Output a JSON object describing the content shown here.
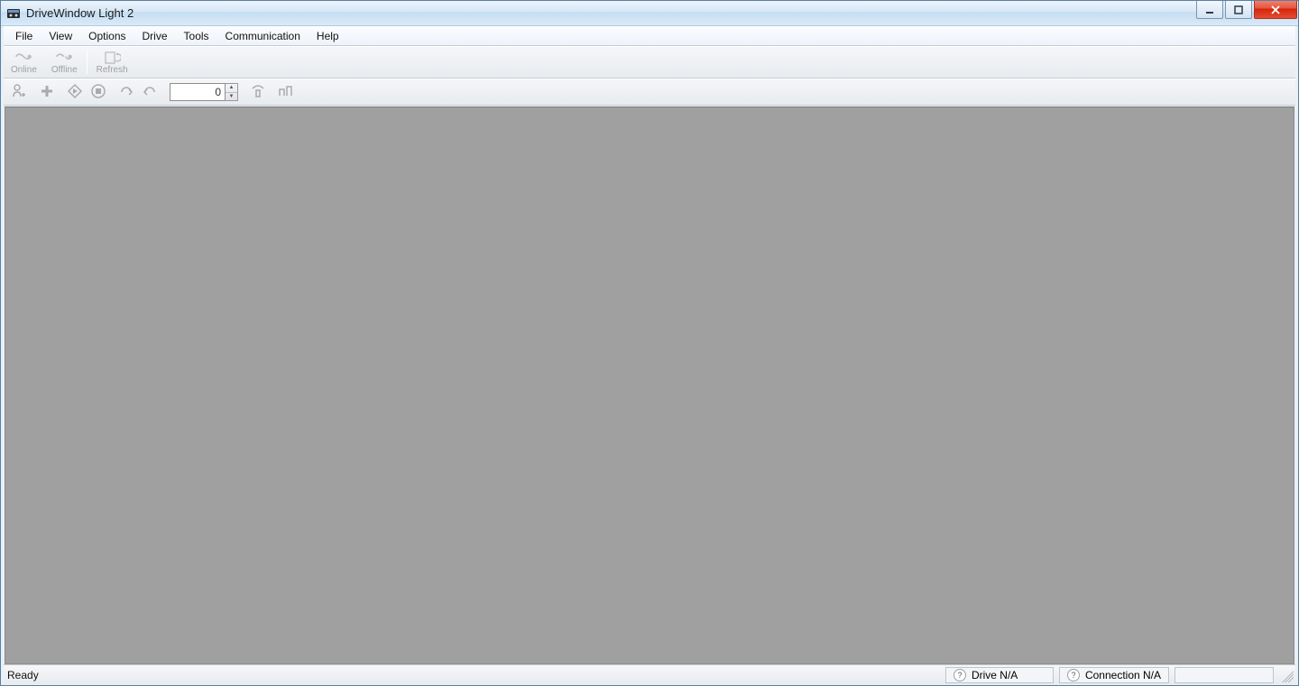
{
  "window": {
    "title": "DriveWindow Light 2"
  },
  "menu": {
    "items": [
      "File",
      "View",
      "Options",
      "Drive",
      "Tools",
      "Communication",
      "Help"
    ]
  },
  "toolbar1": {
    "online": "Online",
    "offline": "Offline",
    "refresh": "Refresh"
  },
  "toolbar2": {
    "numeric_value": "0"
  },
  "status": {
    "ready": "Ready",
    "drive": "Drive N/A",
    "connection": "Connection N/A"
  }
}
